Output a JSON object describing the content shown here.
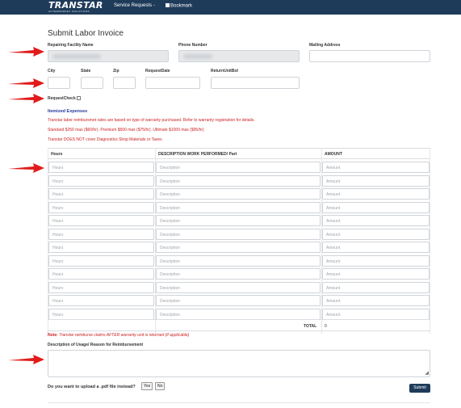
{
  "navbar": {
    "brand": "TRANSTAR",
    "brand_sub": "AFTERMARKET SOLUTIONS",
    "services_label": "Service Requests -",
    "bookmark_label": "Bookmark"
  },
  "page": {
    "title": "Submit Labor Invoice"
  },
  "fields": {
    "repairing_facility_label": "Repairing Facility Name",
    "phone_label": "Phone Number",
    "mailing_label": "Mailing Address",
    "city_label": "City",
    "state_label": "State",
    "zip_label": "Zip",
    "request_date_label": "RequestDate",
    "return_unit_label": "ReturnUnitBol",
    "request_check_label": "RequestCheck"
  },
  "expenses": {
    "title": "Itemized Expenses",
    "line1": "Transtar labor reimbursmet rates are based on type of warranty purchased. Refer to warranty registration for details.",
    "line2": "Standard $250 max ($60/hr). Premium $500 max ($75/hr). Ultimate $1000 max ($95/hr)",
    "line3": "Transtar DOES NOT cover Diagnostics Shop Materials or Taxes"
  },
  "table": {
    "headers": [
      "Hours",
      "DESCRIPTION WORK PERFORMED/ Part",
      "AMOUNT"
    ],
    "placeholders": {
      "hours": "Hours",
      "description": "Description",
      "amount": "Amount"
    },
    "row_count": 12,
    "total_label": "TOTAL",
    "total_value": "0"
  },
  "note": {
    "label": "Note:",
    "text": "Transtar reimburse claims AFTER warranty unit is returned (if applicable)"
  },
  "description": {
    "label": "Description of Usage/ Reason for Reimbursement"
  },
  "upload": {
    "question": "Do you want to upload a .pdf file instead?",
    "yes": "Yes",
    "no": "No"
  },
  "submit_label": "Submit",
  "colors": {
    "navbar": "#1f3b5a",
    "accent_red": "#cc2222",
    "section_blue": "#243a9c",
    "arrow_red": "#e11b1b"
  }
}
